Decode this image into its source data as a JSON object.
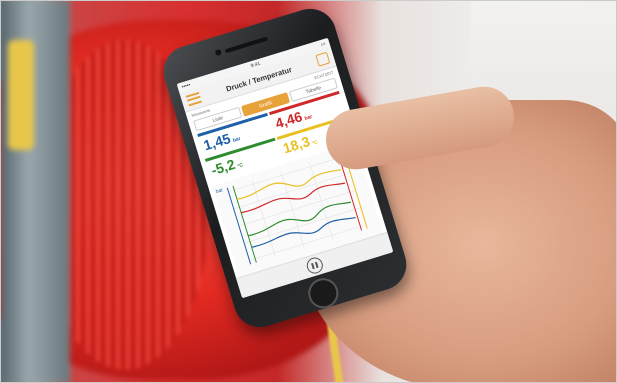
{
  "app": {
    "status_time": "9:41",
    "title": "Druck / Temperatur",
    "sub_left": "Messwerte",
    "sub_right": "ECHTZEIT",
    "tabs": [
      "Liste",
      "Grafik",
      "Tabelle"
    ],
    "active_tab": "Grafik",
    "readings": [
      {
        "value": "1,45",
        "unit": "bar",
        "color": "#1f5fa8"
      },
      {
        "value": "4,46",
        "unit": "bar",
        "color": "#d02828"
      },
      {
        "value": "-5,2",
        "unit": "°C",
        "color": "#2e8b2e"
      },
      {
        "value": "18,3",
        "unit": "°C",
        "color": "#e8c020"
      }
    ],
    "chart_axis_left": "bar",
    "chart_axis_right": "°C",
    "icons": {
      "menu": "hamburger-menu-icon",
      "share": "share-icon",
      "pause": "pause-icon"
    }
  },
  "colors": {
    "accent": "#e8a23a",
    "blue": "#1f5fa8",
    "red": "#d02828",
    "green": "#2e8b2e",
    "yellow": "#e8c020"
  }
}
